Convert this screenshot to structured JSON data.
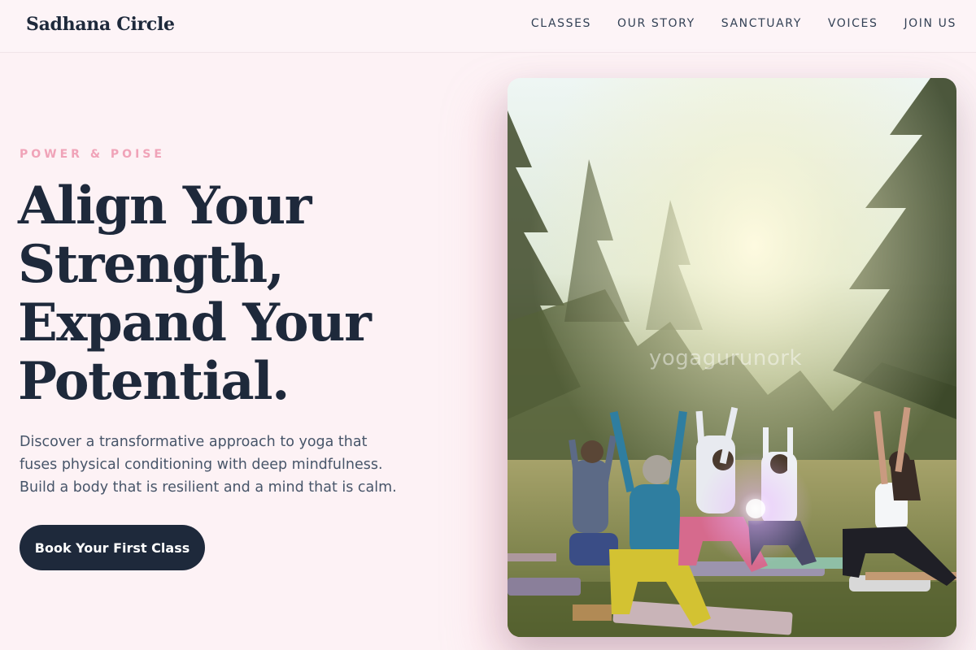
{
  "header": {
    "brand": "Sadhana Circle",
    "nav": [
      "CLASSES",
      "OUR STORY",
      "SANCTUARY",
      "VOICES",
      "JOIN US"
    ]
  },
  "hero": {
    "eyebrow": "POWER & POISE",
    "headline_lines": [
      "Align Your",
      "Strength,",
      "Expand Your",
      "Potential."
    ],
    "lede_lines": [
      "Discover a transformative approach to yoga that",
      "fuses physical conditioning with deep mindfulness.",
      "Build a body that is resilient and a mind that is calm."
    ],
    "cta_label": "Book Your First Class"
  },
  "photo": {
    "watermark": "yogagurunork"
  },
  "colors": {
    "background": "#fdf2f5",
    "ink": "#1e293b",
    "accent_pink": "#f0a3b8",
    "button": "#1e293b"
  }
}
